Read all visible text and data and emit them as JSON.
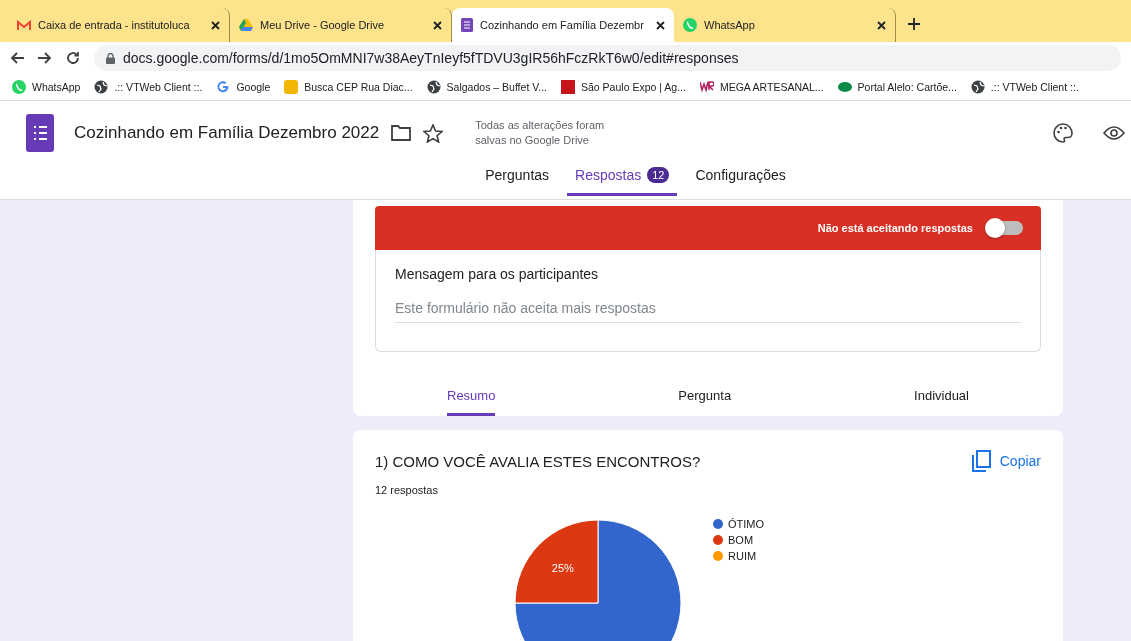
{
  "browser": {
    "tabs": [
      {
        "title": "Caixa de entrada - institutoluca",
        "kind": "mail",
        "selected": false
      },
      {
        "title": "Meu Drive - Google Drive",
        "kind": "drive",
        "selected": false
      },
      {
        "title": "Cozinhando em Família Dezembr",
        "kind": "form",
        "selected": true
      },
      {
        "title": "WhatsApp",
        "kind": "chat",
        "selected": false
      }
    ],
    "address": "docs.google.com/forms/d/1mo5OmMNI7w38AeyTnIeyf5fTDVU3gIR56hFczRkT6w0/edit#responses",
    "bookmarks": [
      {
        "label": "WhatsApp",
        "kind": "chat"
      },
      {
        "label": ".:: VTWeb Client ::.",
        "kind": "globe"
      },
      {
        "label": "Google",
        "kind": "g"
      },
      {
        "label": "Busca CEP Rua Diac...",
        "kind": "cep"
      },
      {
        "label": "Salgados – Buffet V...",
        "kind": "globe"
      },
      {
        "label": "São Paulo Expo | Ag...",
        "kind": "expo"
      },
      {
        "label": "MEGA ARTESANAL...",
        "kind": "wr"
      },
      {
        "label": "Portal Alelo: Cartõe...",
        "kind": "alelo"
      },
      {
        "label": ".:: VTWeb Client ::.",
        "kind": "globe"
      }
    ]
  },
  "form_header": {
    "title": "Cozinhando em Família Dezembro 2022",
    "save_status": "Todas as alterações foram salvas no Google Drive",
    "nav_tabs": [
      {
        "label": "Perguntas",
        "selected": false
      },
      {
        "label": "Respostas",
        "badge": "12",
        "selected": true
      },
      {
        "label": "Configurações",
        "selected": false
      }
    ]
  },
  "responses_card": {
    "banner_label": "Não está aceitando respostas",
    "accepting": false,
    "message_label": "Mensagem para os participantes",
    "message_value": "Este formulário não aceita mais respostas",
    "view_tabs": [
      {
        "label": "Resumo",
        "selected": true
      },
      {
        "label": "Pergunta",
        "selected": false
      },
      {
        "label": "Individual",
        "selected": false
      }
    ]
  },
  "question": {
    "title": "1) COMO VOCÊ AVALIA ESTES ENCONTROS?",
    "count": "12 respostas",
    "copy_label": "Copiar",
    "chart_data": {
      "type": "pie",
      "categories": [
        "ÓTIMO",
        "BOM",
        "RUIM"
      ],
      "values": [
        75,
        25,
        0
      ],
      "colors": [
        "#3366cc",
        "#dc3912",
        "#ff9900"
      ],
      "value_labels": [
        null,
        "25%",
        null
      ],
      "legend": "right"
    }
  }
}
